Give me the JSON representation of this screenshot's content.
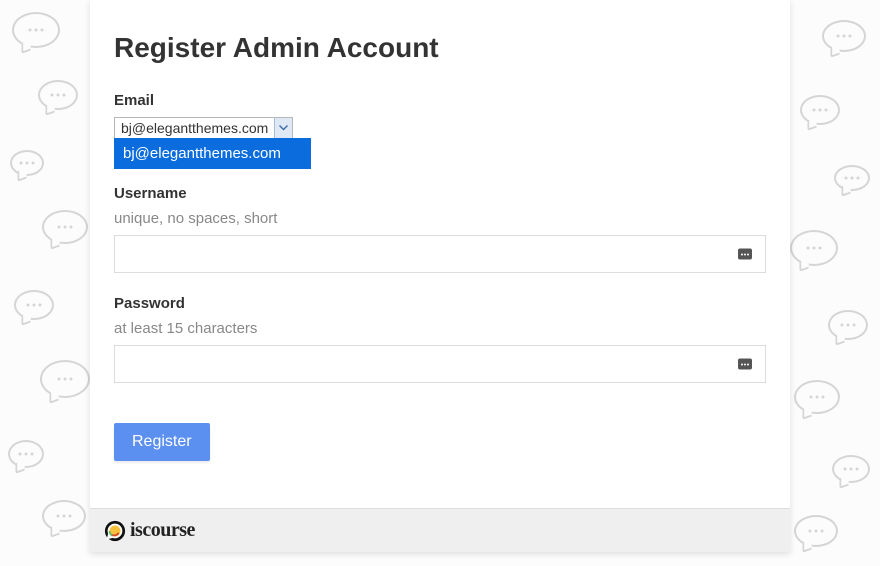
{
  "page": {
    "title": "Register Admin Account"
  },
  "email": {
    "label": "Email",
    "selected": "bj@elegantthemes.com",
    "options": [
      "bj@elegantthemes.com"
    ]
  },
  "username": {
    "label": "Username",
    "hint": "unique, no spaces, short",
    "value": ""
  },
  "password": {
    "label": "Password",
    "hint": "at least 15 characters",
    "value": ""
  },
  "actions": {
    "submit": "Register"
  },
  "footer": {
    "brand": "iscourse"
  }
}
